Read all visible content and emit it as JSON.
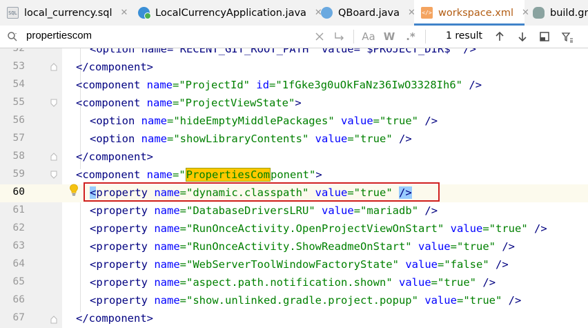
{
  "tabs": [
    {
      "label": "local_currency.sql",
      "icon": "sql-file-icon",
      "close": "✕"
    },
    {
      "label": "LocalCurrencyApplication.java",
      "icon": "java-class-icon",
      "close": "✕"
    },
    {
      "label": "QBoard.java",
      "icon": "java-class-icon",
      "close": "✕"
    },
    {
      "label": "workspace.xml",
      "icon": "xml-file-icon",
      "close": "✕",
      "active": true
    },
    {
      "label": "build.gra",
      "icon": "gradle-icon",
      "close": ""
    }
  ],
  "search": {
    "query": "propertiescom",
    "result_count": "1 result",
    "match_case": "Aa",
    "whole_word": "W",
    "regex": ".*"
  },
  "editor": {
    "lines": [
      {
        "n": "52",
        "partial": "<option name=\"RECENT_GIT_ROOT_PATH\" value=\"$PROJECT_DIR$\" />"
      },
      {
        "n": "53"
      },
      {
        "n": "54",
        "name": "ProjectId",
        "id": "1fGke3g0uOkFaNz36IwO3328Ih6"
      },
      {
        "n": "55",
        "name": "ProjectViewState"
      },
      {
        "n": "56",
        "name": "hideEmptyMiddlePackages",
        "value": "true"
      },
      {
        "n": "57",
        "name": "showLibraryContents",
        "value": "true"
      },
      {
        "n": "58"
      },
      {
        "n": "59",
        "match": "PropertiesCom",
        "rest": "ponent"
      },
      {
        "n": "60",
        "name": "dynamic.classpath",
        "value": "true"
      },
      {
        "n": "61",
        "name": "DatabaseDriversLRU",
        "value": "mariadb"
      },
      {
        "n": "62",
        "name": "RunOnceActivity.OpenProjectViewOnStart",
        "value": "true"
      },
      {
        "n": "63",
        "name": "RunOnceActivity.ShowReadmeOnStart",
        "value": "true"
      },
      {
        "n": "64",
        "name": "WebServerToolWindowFactoryState",
        "value": "false"
      },
      {
        "n": "65",
        "name": "aspect.path.notification.shown",
        "value": "true"
      },
      {
        "n": "66",
        "name": "show.unlinked.gradle.project.popup",
        "value": "true"
      },
      {
        "n": "67"
      }
    ]
  },
  "colors": {
    "tag": "#000080",
    "attribute": "#0000ff",
    "value": "#008000",
    "highlight_box": "#d01f1f",
    "active_tab_text": "#b25c12"
  }
}
